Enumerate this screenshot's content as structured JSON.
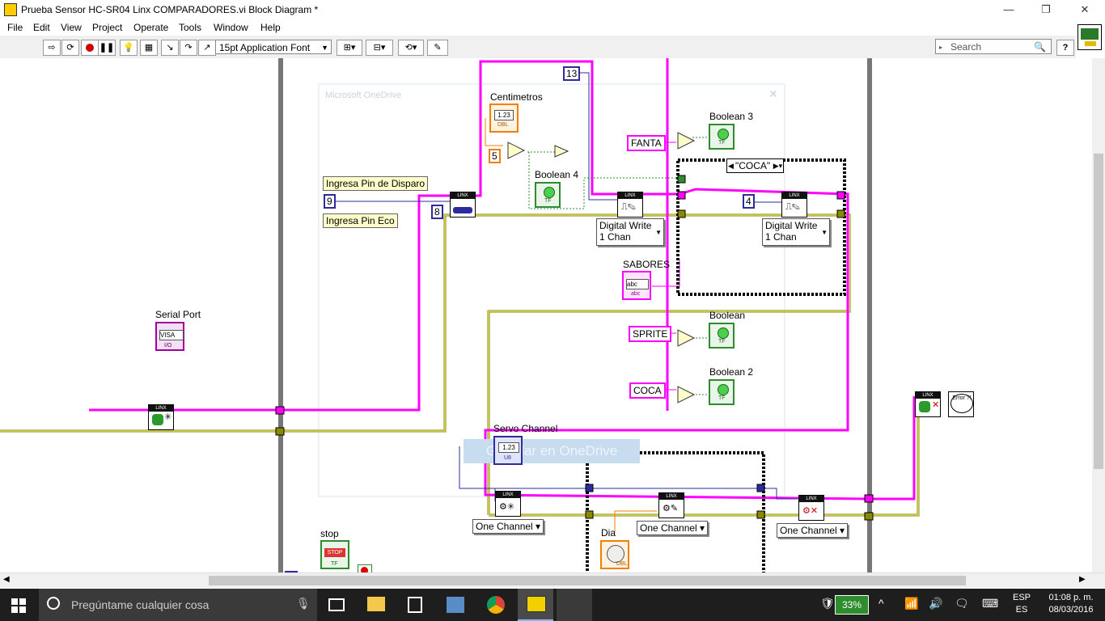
{
  "window": {
    "title": "Prueba Sensor HC-SR04 Linx COMPARADORES.vi Block Diagram *",
    "minimize": "—",
    "restore": "❐",
    "close": "✕"
  },
  "menu": [
    "File",
    "Edit",
    "View",
    "Project",
    "Operate",
    "Tools",
    "Window",
    "Help"
  ],
  "toolbar": {
    "font": "15pt Application Font",
    "search_placeholder": "Search",
    "help": "?"
  },
  "diagram": {
    "ghost_panel_title": "Microsoft OneDrive",
    "ghost_panel_text": "Guardar en OneDrive",
    "labels": {
      "centimetros": "Centimetros",
      "boolean3": "Boolean 3",
      "boolean4": "Boolean 4",
      "boolean": "Boolean",
      "boolean2": "Boolean 2",
      "sabores": "SABORES",
      "serial_port": "Serial Port",
      "servo_channel": "Servo Channel",
      "stop": "stop",
      "dia": "Dia"
    },
    "comments": {
      "pin_disparo": "Ingresa Pin de Disparo",
      "pin_eco": "Ingresa Pin Eco"
    },
    "constants": {
      "n9": "9",
      "n8": "8",
      "n5": "5",
      "n13": "13",
      "n4": "4",
      "fanta": "FANTA",
      "sprite": "SPRITE",
      "coca": "COCA",
      "case_selector": "\"COCA\""
    },
    "rings": {
      "dw1": "Digital Write\n1 Chan",
      "dw2": "Digital Write\n1 Chan",
      "one_channel_1": "One Channel",
      "one_channel_2": "One Channel",
      "one_channel_3": "One Channel"
    },
    "terminal_text": {
      "visa": "VISA",
      "num123": "1.23",
      "dbl": "DBL",
      "u8": "U8",
      "tf": "TF",
      "abc": "abc",
      "stop": "STOP",
      "error": "Error ?!"
    }
  },
  "taskbar": {
    "search_placeholder": "Pregúntame cualquier cosa",
    "battery": "33%",
    "lang1": "ESP",
    "lang2": "ES",
    "time": "01:08 p. m.",
    "date": "08/03/2016"
  },
  "colors": {
    "string_wire": "#ff00ff",
    "resource_wire": "#8a8a00",
    "numeric_wire": "#2c2c9c",
    "boolean_wire": "#2e8b2e",
    "dbl_wire": "#f08000",
    "structure_gray": "#777777"
  }
}
